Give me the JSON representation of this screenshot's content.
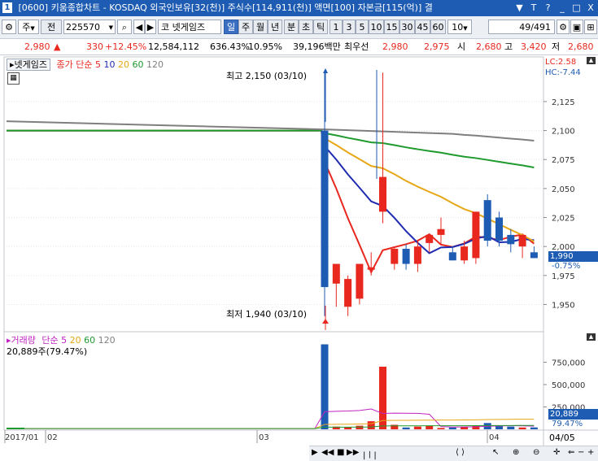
{
  "titlebar": {
    "number": "1",
    "title": "[0600] 키움종합차트 - KOSDAQ 외국인보유[32(천)] 주식수[114,911(천)] 액면[100] 자본금[115(억)] 결",
    "controls": [
      "▼",
      "T",
      "?",
      "_",
      "□",
      "X"
    ]
  },
  "toolbar": {
    "market": "주",
    "market_dropdown": "▼",
    "all_label": "전",
    "code": "225570",
    "code_dropdown": "▼",
    "search_icon": "search-icon",
    "nav_prev": "◀",
    "nav_next": "▶",
    "stock_name": "코 넷게임즈",
    "periods": [
      "일",
      "주",
      "월",
      "년",
      "분",
      "초",
      "틱"
    ],
    "intervals": [
      "1",
      "3",
      "5",
      "10",
      "15",
      "30",
      "45",
      "60",
      "10"
    ],
    "interval_dropdown": "▼",
    "page_counter": "49/491",
    "tool_icons": [
      "settings-icon",
      "save-icon",
      "grid-icon"
    ]
  },
  "quote": {
    "price": "2,980",
    "arrow": "▲",
    "change": "330",
    "change_pct": "+12.45%",
    "volume": "12,584,112",
    "volume_pct": "636.43%",
    "turnover": "10.95%",
    "amount": "39,196백만",
    "bid_label": "최우선",
    "bid1": "2,980",
    "bid2": "2,975",
    "open_label": "시",
    "open": "2,680",
    "high_label": "고",
    "high": "3,420",
    "low_label": "저",
    "low": "2,680"
  },
  "price_panel": {
    "stock_tab": "넷게임즈",
    "legend_prefix": "종가 단순",
    "ma_labels": [
      "5",
      "10",
      "20",
      "60",
      "120"
    ],
    "ma_colors": [
      "#e8281f",
      "#1f2bb0",
      "#e6a817",
      "#1f9a2e",
      "#7f7f7f"
    ],
    "lc_label": "LC:2.58",
    "hc_label": "HC:-7.44",
    "max_label": "최고 2,150 (03/10)",
    "min_label": "최저 1,940 (03/10)",
    "y_ticks": [
      "2,125",
      "2,100",
      "2,075",
      "2,050",
      "2,025",
      "2,000",
      "1,975",
      "1,950"
    ],
    "current_price": "1,990",
    "current_pct": "-0.75%"
  },
  "volume_panel": {
    "legend_label": "거래량",
    "legend_prefix": "단순",
    "ma_labels": [
      "5",
      "20",
      "60",
      "120"
    ],
    "ma_colors": [
      "#c023c0",
      "#e6a817",
      "#1f9a2e",
      "#7f7f7f"
    ],
    "current_volume": "20,889주(79.47%)",
    "y_ticks": [
      "750,000",
      "500,000",
      "250,000"
    ],
    "current_label": "20,889",
    "current_pct": "79.47%"
  },
  "x_axis": {
    "labels": [
      "2017/01",
      "02",
      "03",
      "04"
    ],
    "right_label": "04/05"
  },
  "chart_data": {
    "type": "candlestick",
    "candles": [
      {
        "open": 2100,
        "high": 2150,
        "low": 1940,
        "close": 1965
      },
      {
        "open": 1968,
        "high": 1985,
        "low": 1948,
        "close": 1985
      },
      {
        "open": 1948,
        "high": 1975,
        "low": 1940,
        "close": 1972
      },
      {
        "open": 1955,
        "high": 1985,
        "low": 1950,
        "close": 1985
      },
      {
        "open": 1980,
        "high": 1995,
        "low": 1975,
        "close": 1982
      },
      {
        "open": 2030,
        "high": 2150,
        "low": 2020,
        "close": 2060
      },
      {
        "open": 1985,
        "high": 2000,
        "low": 1980,
        "close": 1998
      },
      {
        "open": 1998,
        "high": 2002,
        "low": 1980,
        "close": 1985
      },
      {
        "open": 1985,
        "high": 2005,
        "low": 1978,
        "close": 2000
      },
      {
        "open": 2003,
        "high": 2010,
        "low": 1995,
        "close": 2010
      },
      {
        "open": 2010,
        "high": 2025,
        "low": 2002,
        "close": 2015
      },
      {
        "open": 1995,
        "high": 2000,
        "low": 1988,
        "close": 1988
      },
      {
        "open": 1988,
        "high": 2005,
        "low": 1985,
        "close": 2000
      },
      {
        "open": 1990,
        "high": 2030,
        "low": 1985,
        "close": 2030
      },
      {
        "open": 2040,
        "high": 2045,
        "low": 2000,
        "close": 2005
      },
      {
        "open": 2025,
        "high": 2030,
        "low": 2000,
        "close": 2005
      },
      {
        "open": 2010,
        "high": 2015,
        "low": 1995,
        "close": 2002
      },
      {
        "open": 2000,
        "high": 2010,
        "low": 1990,
        "close": 2010
      },
      {
        "open": 1995,
        "high": 2000,
        "low": 1990,
        "close": 1990
      }
    ],
    "volumes": [
      950000,
      30000,
      25000,
      40000,
      90000,
      700000,
      50000,
      20000,
      30000,
      40000,
      15000,
      20000,
      25000,
      40000,
      70000,
      35000,
      30000,
      20000,
      20889
    ],
    "y_range": [
      1930,
      2160
    ],
    "volume_range": [
      0,
      1000000
    ]
  }
}
